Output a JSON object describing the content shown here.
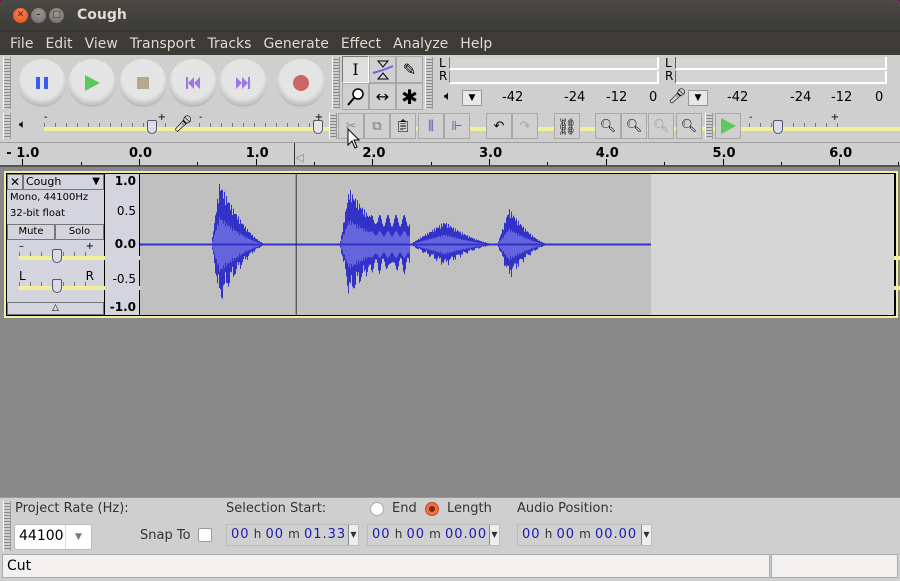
{
  "window": {
    "title": "Cough"
  },
  "menu": [
    "File",
    "Edit",
    "View",
    "Transport",
    "Tracks",
    "Generate",
    "Effect",
    "Analyze",
    "Help"
  ],
  "transport": {
    "buttons": [
      {
        "name": "pause",
        "icon": "pause-icon",
        "color": "#3b5de8"
      },
      {
        "name": "play",
        "icon": "play-icon",
        "color": "#5cc95c"
      },
      {
        "name": "stop",
        "icon": "stop-icon",
        "color": "#b8a88a"
      },
      {
        "name": "skip-to-start",
        "icon": "skip-start-icon",
        "color": "#9a7ae0"
      },
      {
        "name": "skip-to-end",
        "icon": "skip-end-icon",
        "color": "#9a7ae0"
      },
      {
        "name": "record",
        "icon": "record-icon",
        "color": "#cc6666"
      }
    ]
  },
  "tools": [
    {
      "name": "selection-tool",
      "glyph": "I",
      "active": true
    },
    {
      "name": "envelope-tool",
      "glyph": "⧖",
      "active": false
    },
    {
      "name": "draw-tool",
      "glyph": "✎",
      "active": false
    },
    {
      "name": "zoom-tool",
      "glyph": "🔍",
      "active": false
    },
    {
      "name": "time-shift-tool",
      "glyph": "↔",
      "active": false
    },
    {
      "name": "multi-tool",
      "glyph": "✱",
      "active": false
    }
  ],
  "meters": {
    "channels": [
      "L",
      "R"
    ],
    "playback_scale": [
      "-42",
      "-24",
      "-12",
      "0"
    ],
    "record_scale": [
      "-42",
      "-24",
      "-12",
      "0"
    ]
  },
  "mixer": {
    "playback_volume": 0.92,
    "record_volume": 1.0,
    "minus": "-",
    "plus": "+"
  },
  "edit_toolbar": {
    "buttons": [
      "cut",
      "copy",
      "paste",
      "trim",
      "silence",
      "undo",
      "redo",
      "sync-lock",
      "zoom-in",
      "zoom-out",
      "fit-selection",
      "fit-project"
    ]
  },
  "play_at_speed": {
    "speed": 0.3,
    "minus": "-",
    "plus": "+"
  },
  "ruler": {
    "labels": [
      "- 1.0",
      "0.0",
      "1.0",
      "2.0",
      "3.0",
      "4.0",
      "5.0",
      "6.0"
    ]
  },
  "track": {
    "name": "Cough",
    "info1": "Mono, 44100Hz",
    "info2": "32-bit float",
    "mute": "Mute",
    "solo": "Solo",
    "gain": 0.5,
    "pan": 0.5,
    "pan_left": "L",
    "pan_right": "R",
    "vruler": [
      "1.0",
      "0.5",
      "0.0",
      "-0.5",
      "-1.0"
    ],
    "cursor_time_s": 1.33,
    "clip_end_s": 4.37,
    "colors": {
      "wave": "#3232c8",
      "rms": "#6464dc",
      "bg": "#c0c0c0",
      "selected_bg": "#d6d6d6",
      "border": "#f2f09c"
    }
  },
  "selection": {
    "project_rate_label": "Project Rate (Hz):",
    "project_rate": "44100",
    "snap_to": "Snap To",
    "snap_checked": false,
    "selection_start_label": "Selection Start:",
    "end_label": "End",
    "length_label": "Length",
    "length_selected": true,
    "audio_position_label": "Audio Position:",
    "start_time": {
      "h": "00",
      "m": "00",
      "s": "01.33"
    },
    "length_time": {
      "h": "00",
      "m": "00",
      "s": "00.00"
    },
    "position_time": {
      "h": "00",
      "m": "00",
      "s": "00.00"
    },
    "unit_h": "h",
    "unit_m": "m",
    "unit_s": "s"
  },
  "status": {
    "text": "Cut"
  }
}
